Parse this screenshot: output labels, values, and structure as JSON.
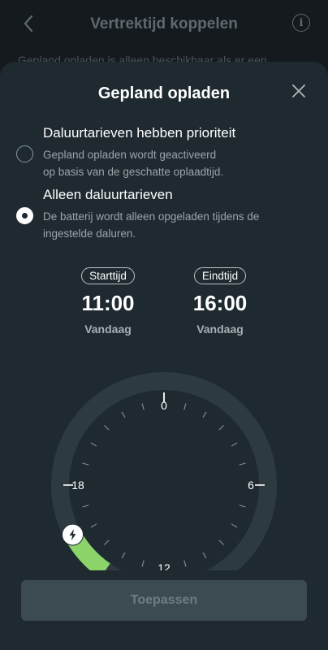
{
  "background": {
    "title": "Vertrektijd koppelen",
    "text": "Gepland opladen is alleen beschikbaar als er een"
  },
  "sheet": {
    "title": "Gepland opladen",
    "options": [
      {
        "title": "Daluurtarieven hebben prioriteit",
        "desc_line1": "Gepland opladen wordt geactiveerd",
        "desc_line2": "op basis van de geschatte oplaadtijd.",
        "selected": false
      },
      {
        "title": "Alleen daluurtarieven",
        "desc_line1": "De batterij wordt alleen opgeladen tijdens de",
        "desc_line2": "ingestelde daluren.",
        "selected": true
      }
    ],
    "start": {
      "label": "Starttijd",
      "time": "11:00",
      "day": "Vandaag"
    },
    "end": {
      "label": "Eindtijd",
      "time": "16:00",
      "day": "Vandaag"
    },
    "dial": {
      "labels": {
        "top": "0",
        "right": "6",
        "bottom": "12",
        "left": "18"
      },
      "range_start_hour": 11,
      "range_end_hour": 16,
      "accent_color": "#8cd36a"
    },
    "apply_label": "Toepassen"
  },
  "colors": {
    "background": "#141a1e",
    "sheet": "#1e2a30",
    "ring": "#2d3a40",
    "button": "#3c4a51"
  }
}
